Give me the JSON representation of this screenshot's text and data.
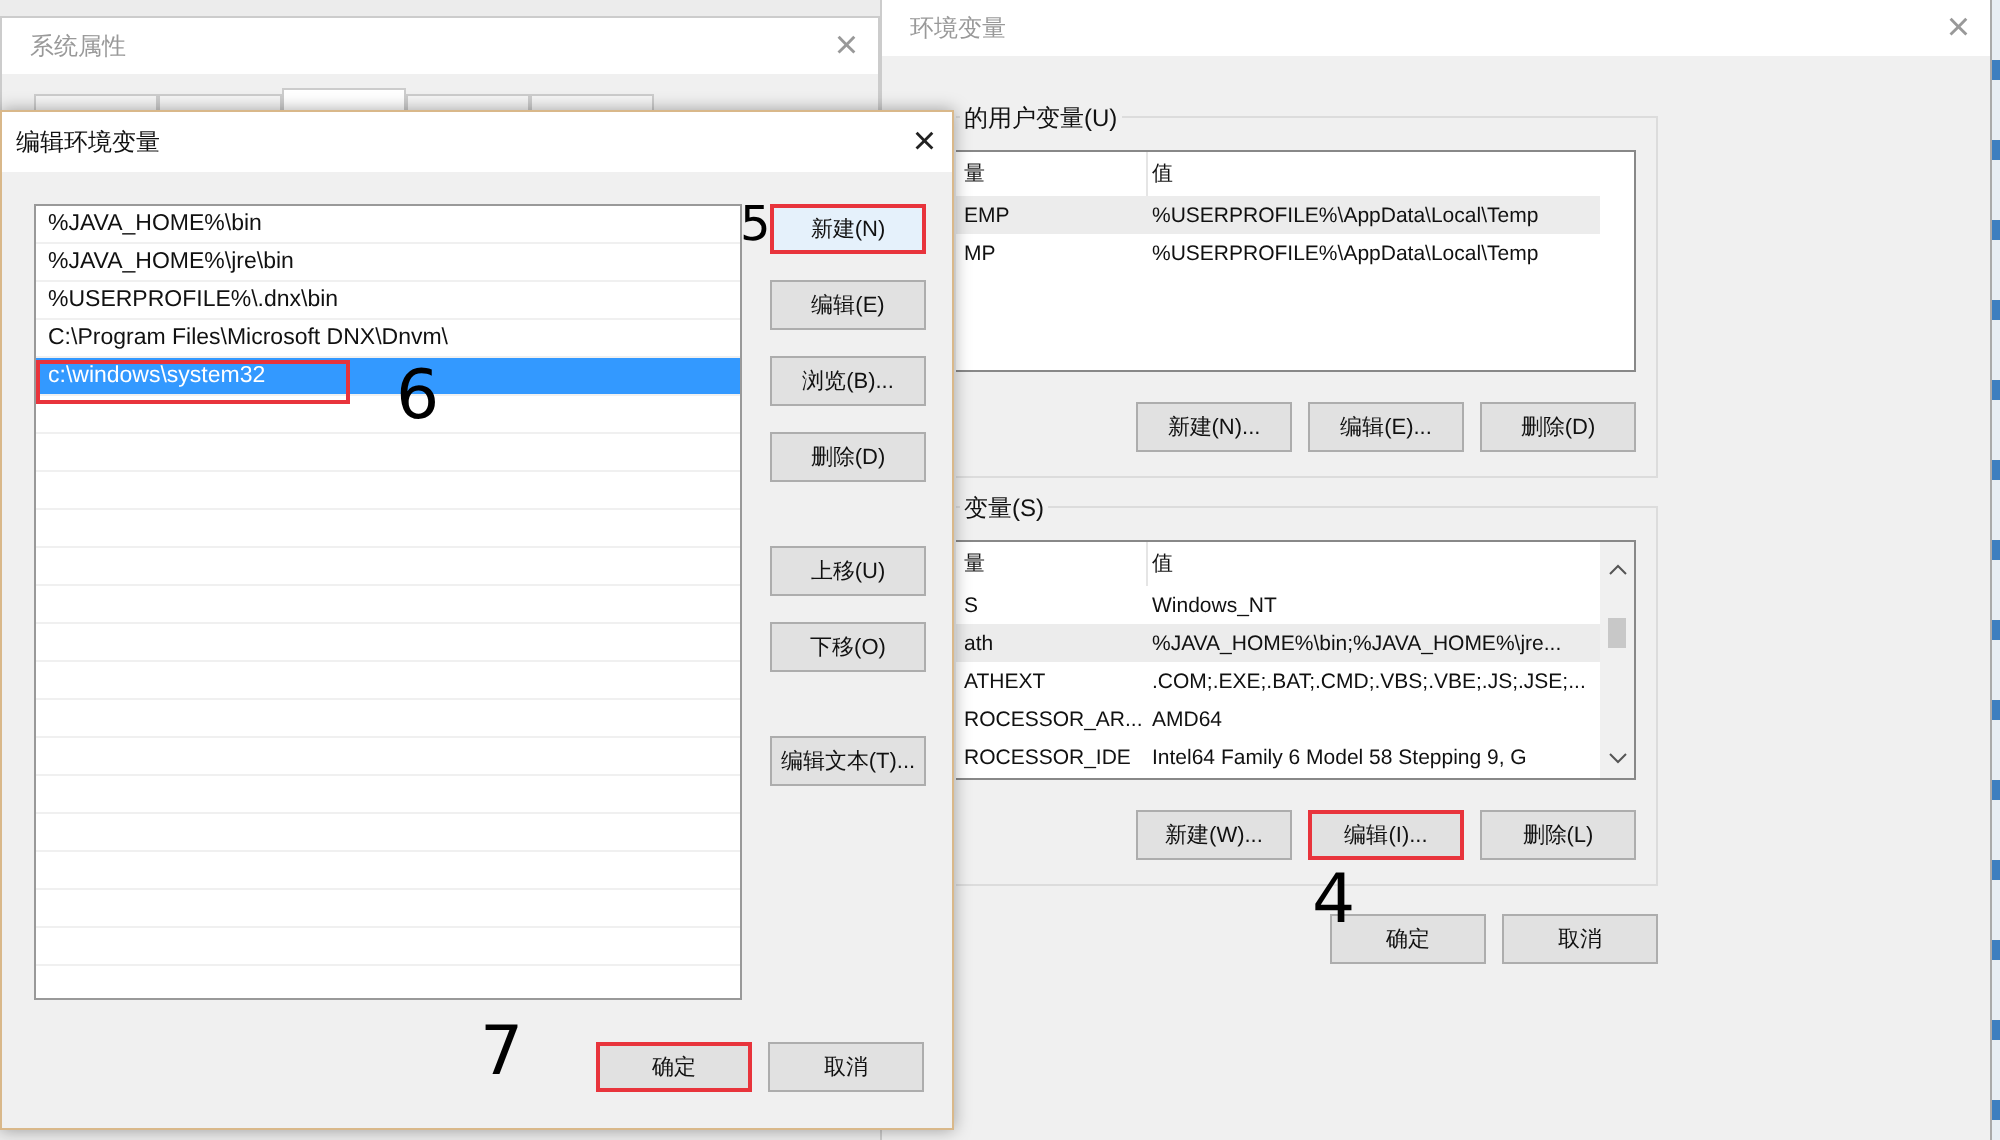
{
  "back_window": {
    "title": "系统属性",
    "close": "×",
    "tabs": [
      {
        "selected": false
      },
      {
        "selected": false
      },
      {
        "selected": true
      },
      {
        "selected": false
      },
      {
        "selected": false
      }
    ]
  },
  "env_window": {
    "title": "环境变量",
    "close": "×",
    "user_group": {
      "label": "的用户变量(U)",
      "columns": [
        "量",
        "值"
      ],
      "rows": [
        {
          "name": "EMP",
          "value": "%USERPROFILE%\\AppData\\Local\\Temp",
          "selected": true
        },
        {
          "name": "MP",
          "value": "%USERPROFILE%\\AppData\\Local\\Temp",
          "selected": false
        }
      ],
      "buttons": [
        {
          "label": "新建(N)...",
          "highlighted": false
        },
        {
          "label": "编辑(E)...",
          "highlighted": false
        },
        {
          "label": "删除(D)",
          "highlighted": false
        }
      ]
    },
    "system_group": {
      "label": "变量(S)",
      "columns": [
        "量",
        "值"
      ],
      "rows": [
        {
          "name": "S",
          "value": "Windows_NT",
          "selected": false
        },
        {
          "name": "ath",
          "value": "%JAVA_HOME%\\bin;%JAVA_HOME%\\jre...",
          "selected": true
        },
        {
          "name": "ATHEXT",
          "value": ".COM;.EXE;.BAT;.CMD;.VBS;.VBE;.JS;.JSE;...",
          "selected": false
        },
        {
          "name": "ROCESSOR_AR...",
          "value": "AMD64",
          "selected": false
        },
        {
          "name": "ROCESSOR_IDE",
          "value": "Intel64 Family 6 Model 58 Stepping 9, G",
          "selected": false
        }
      ],
      "buttons": [
        {
          "label": "新建(W)...",
          "highlighted": false
        },
        {
          "label": "编辑(I)...",
          "highlighted": true,
          "annotation": "4"
        },
        {
          "label": "删除(L)",
          "highlighted": false
        }
      ]
    },
    "footer_buttons": [
      {
        "label": "确定",
        "highlighted": false
      },
      {
        "label": "取消",
        "highlighted": false
      }
    ]
  },
  "edit_dialog": {
    "title": "编辑环境变量",
    "close": "×",
    "items": [
      {
        "text": "%JAVA_HOME%\\bin",
        "selected": false,
        "highlighted": false
      },
      {
        "text": "%JAVA_HOME%\\jre\\bin",
        "selected": false,
        "highlighted": false
      },
      {
        "text": "%USERPROFILE%\\.dnx\\bin",
        "selected": false,
        "highlighted": false
      },
      {
        "text": "C:\\Program Files\\Microsoft DNX\\Dnvm\\",
        "selected": false,
        "highlighted": false
      },
      {
        "text": "c:\\windows\\system32",
        "selected": true,
        "highlighted": true,
        "annotation": "6"
      }
    ],
    "side_button_groups": [
      [
        {
          "label": "新建(N)",
          "highlighted": true,
          "focused": true,
          "annotation": "5"
        },
        {
          "label": "编辑(E)",
          "highlighted": false,
          "focused": false
        },
        {
          "label": "浏览(B)...",
          "highlighted": false,
          "focused": false
        },
        {
          "label": "删除(D)",
          "highlighted": false,
          "focused": false
        }
      ],
      [
        {
          "label": "上移(U)",
          "highlighted": false,
          "focused": false
        },
        {
          "label": "下移(O)",
          "highlighted": false,
          "focused": false
        }
      ],
      [
        {
          "label": "编辑文本(T)...",
          "highlighted": false,
          "focused": false
        }
      ]
    ],
    "footer_buttons": [
      {
        "label": "确定",
        "highlighted": true,
        "annotation": "7"
      },
      {
        "label": "取消",
        "highlighted": false
      }
    ]
  }
}
